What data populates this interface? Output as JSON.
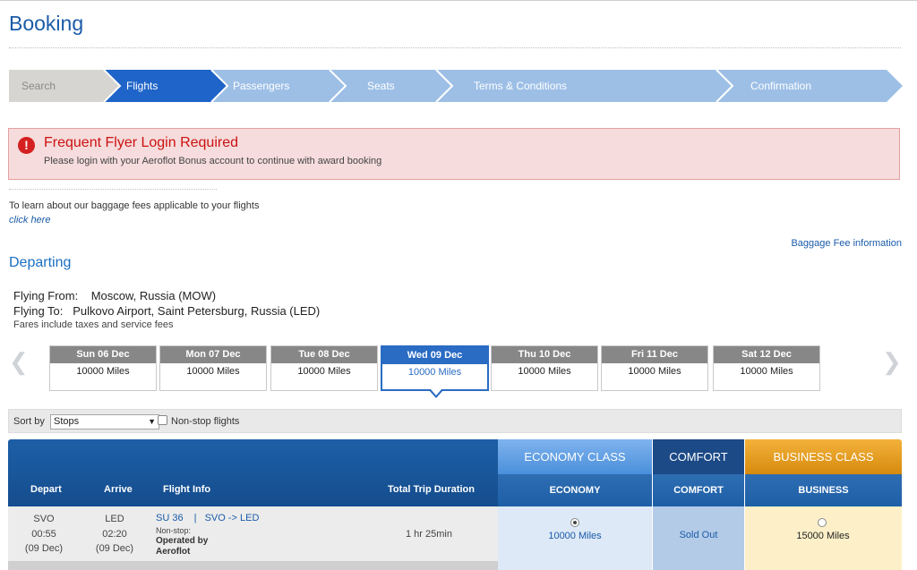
{
  "page": {
    "title": "Booking"
  },
  "steps": [
    {
      "label": "Search",
      "state": "done"
    },
    {
      "label": "Flights",
      "state": "active"
    },
    {
      "label": "Passengers",
      "state": "todo"
    },
    {
      "label": "Seats",
      "state": "todo"
    },
    {
      "label": "Terms & Conditions",
      "state": "todo"
    },
    {
      "label": "Confirmation",
      "state": "todo"
    }
  ],
  "alert": {
    "icon": "!",
    "title": "Frequent Flyer Login Required",
    "message": "Please login with your Aeroflot Bonus account to continue with award booking"
  },
  "baggage": {
    "text": "To learn about our baggage fees applicable to your flights",
    "link": "click here",
    "fee_info": "Baggage Fee information"
  },
  "departing": {
    "title": "Departing",
    "from_label": "Flying From:",
    "from_value": "Moscow, Russia (MOW)",
    "to_label": "Flying To:",
    "to_value": "Pulkovo Airport, Saint Petersburg, Russia (LED)",
    "fares_note": "Fares include taxes and service fees"
  },
  "dates": [
    {
      "day": "Sun 06 Dec",
      "price": "10000  Miles"
    },
    {
      "day": "Mon 07 Dec",
      "price": "10000  Miles"
    },
    {
      "day": "Tue 08 Dec",
      "price": "10000  Miles"
    },
    {
      "day": "Wed 09 Dec",
      "price": "10000  Miles",
      "selected": true
    },
    {
      "day": "Thu 10 Dec",
      "price": "10000  Miles"
    },
    {
      "day": "Fri 11 Dec",
      "price": "10000  Miles"
    },
    {
      "day": "Sat 12 Dec",
      "price": "10000  Miles"
    }
  ],
  "sort": {
    "label": "Sort by",
    "selected": "Stops",
    "nonstop_label": "Non-stop flights",
    "nonstop_checked": false
  },
  "table": {
    "columns": {
      "depart": "Depart",
      "arrive": "Arrive",
      "flight_info": "Flight Info",
      "duration": "Total Trip Duration"
    },
    "classes": {
      "economy_top": "ECONOMY CLASS",
      "economy_sub": "ECONOMY",
      "comfort_top": "COMFORT",
      "comfort_sub": "COMFORT",
      "business_top": "BUSINESS CLASS",
      "business_sub": "BUSINESS"
    },
    "rows": [
      {
        "depart_code": "SVO",
        "depart_time": "00:55",
        "depart_date": "(09 Dec)",
        "arrive_code": "LED",
        "arrive_time": "02:20",
        "arrive_date": "(09 Dec)",
        "flight_no": "SU 36",
        "separator": "|",
        "route": "SVO -> LED",
        "stops": "Non-stop:",
        "operated_by": "Operated by",
        "carrier": "Aeroflot",
        "duration": "1 hr 25min",
        "economy_price": "10000  Miles",
        "economy_selected": true,
        "comfort_status": "Sold Out",
        "business_price": "15000  Miles",
        "business_selected": false
      }
    ]
  }
}
